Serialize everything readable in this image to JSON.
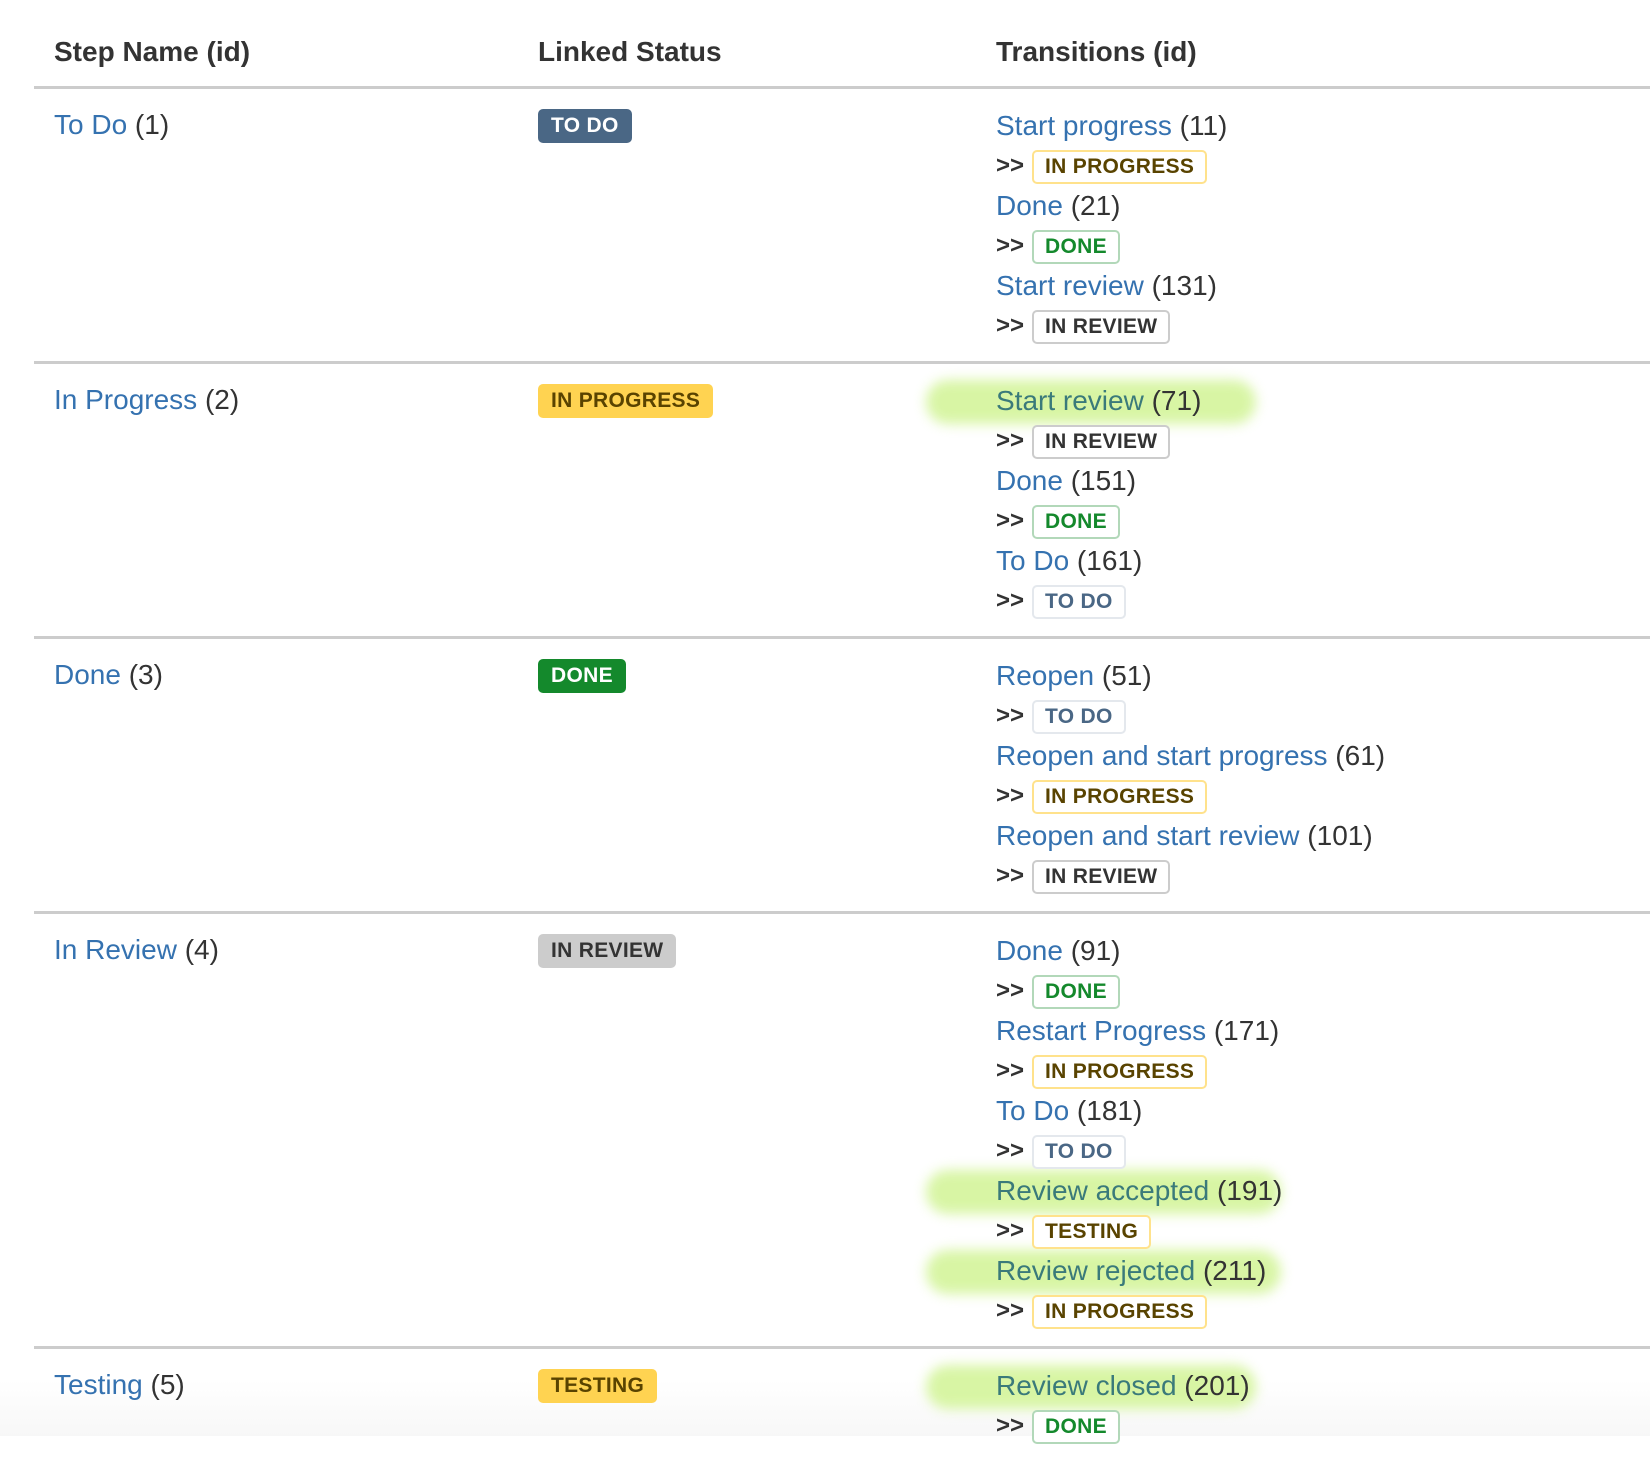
{
  "table": {
    "headers": {
      "step": "Step Name (id)",
      "status": "Linked Status",
      "transitions": "Transitions (id)"
    },
    "arrow": ">>",
    "rows": [
      {
        "step_name": "To Do",
        "step_id": "(1)",
        "status": "TO DO",
        "status_type": "todo",
        "transitions": [
          {
            "name": "Start progress",
            "id": "(11)",
            "target": "IN PROGRESS",
            "target_type": "inprogress",
            "highlighted": false
          },
          {
            "name": "Done",
            "id": "(21)",
            "target": "DONE",
            "target_type": "done",
            "highlighted": false
          },
          {
            "name": "Start review",
            "id": "(131)",
            "target": "IN REVIEW",
            "target_type": "inreview",
            "highlighted": false
          }
        ]
      },
      {
        "step_name": "In Progress",
        "step_id": "(2)",
        "status": "IN PROGRESS",
        "status_type": "inprogress",
        "transitions": [
          {
            "name": "Start review",
            "id": "(71)",
            "target": "IN REVIEW",
            "target_type": "inreview",
            "highlighted": true
          },
          {
            "name": "Done",
            "id": "(151)",
            "target": "DONE",
            "target_type": "done",
            "highlighted": false
          },
          {
            "name": "To Do",
            "id": "(161)",
            "target": "TO DO",
            "target_type": "todo",
            "highlighted": false
          }
        ]
      },
      {
        "step_name": "Done",
        "step_id": "(3)",
        "status": "DONE",
        "status_type": "done",
        "transitions": [
          {
            "name": "Reopen",
            "id": "(51)",
            "target": "TO DO",
            "target_type": "todo",
            "highlighted": false
          },
          {
            "name": "Reopen and start progress",
            "id": "(61)",
            "target": "IN PROGRESS",
            "target_type": "inprogress",
            "highlighted": false
          },
          {
            "name": "Reopen and start review",
            "id": "(101)",
            "target": "IN REVIEW",
            "target_type": "inreview",
            "highlighted": false
          }
        ]
      },
      {
        "step_name": "In Review",
        "step_id": "(4)",
        "status": "IN REVIEW",
        "status_type": "inreview",
        "transitions": [
          {
            "name": "Done",
            "id": "(91)",
            "target": "DONE",
            "target_type": "done",
            "highlighted": false
          },
          {
            "name": "Restart Progress",
            "id": "(171)",
            "target": "IN PROGRESS",
            "target_type": "inprogress",
            "highlighted": false
          },
          {
            "name": "To Do",
            "id": "(181)",
            "target": "TO DO",
            "target_type": "todo",
            "highlighted": false
          },
          {
            "name": "Review accepted",
            "id": "(191)",
            "target": "TESTING",
            "target_type": "testing",
            "highlighted": true
          },
          {
            "name": "Review rejected",
            "id": "(211)",
            "target": "IN PROGRESS",
            "target_type": "inprogress",
            "highlighted": true
          }
        ]
      },
      {
        "step_name": "Testing",
        "step_id": "(5)",
        "status": "TESTING",
        "status_type": "testing",
        "transitions": [
          {
            "name": "Review closed",
            "id": "(201)",
            "target": "DONE",
            "target_type": "done",
            "highlighted": true
          }
        ]
      }
    ]
  },
  "colors": {
    "link": "#3572b0",
    "todo": "#4a6785",
    "inprogress": "#ffd351",
    "done": "#14892c",
    "inreview": "#cccccc",
    "highlight": "#d6f5a0"
  }
}
